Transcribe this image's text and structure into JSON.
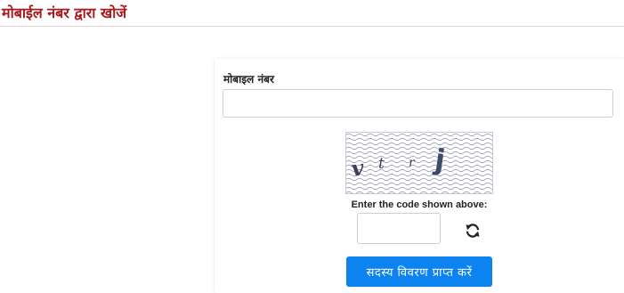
{
  "page": {
    "title": "मोबाईल नंबर द्वारा खोजें"
  },
  "form": {
    "mobile_label": "मोबाइल नंबर",
    "mobile_value": "",
    "captcha": {
      "characters": [
        "v",
        "t",
        "r",
        "j"
      ],
      "instruction": "Enter the code shown above:",
      "code_value": ""
    },
    "refresh_icon": "refresh-icon",
    "submit_label": "सदस्य विवरण प्राप्त करें"
  },
  "colors": {
    "title": "#a6191d",
    "button_bg": "#0d83f0",
    "button_text": "#ffffff",
    "captcha_pattern": "#8a8aa8",
    "captcha_text": "#3a3f5c"
  }
}
